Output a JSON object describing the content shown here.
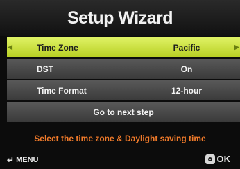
{
  "header": {
    "title": "Setup Wizard"
  },
  "menu": {
    "items": [
      {
        "label": "Time Zone",
        "value": "Pacific",
        "selected": true
      },
      {
        "label": "DST",
        "value": "On",
        "selected": false
      },
      {
        "label": "Time Format",
        "value": "12-hour",
        "selected": false
      }
    ],
    "next_step": "Go to next step"
  },
  "hint": "Select the time zone & Daylight saving time",
  "footer": {
    "menu_label": "MENU",
    "ok_label": "OK"
  },
  "colors": {
    "selected_row": "#cfe245",
    "hint_text": "#f07a2a"
  },
  "icons": {
    "left": "arrow-left-icon",
    "right": "arrow-right-icon",
    "back": "back-arrow-icon",
    "ok": "ok-button-icon"
  }
}
